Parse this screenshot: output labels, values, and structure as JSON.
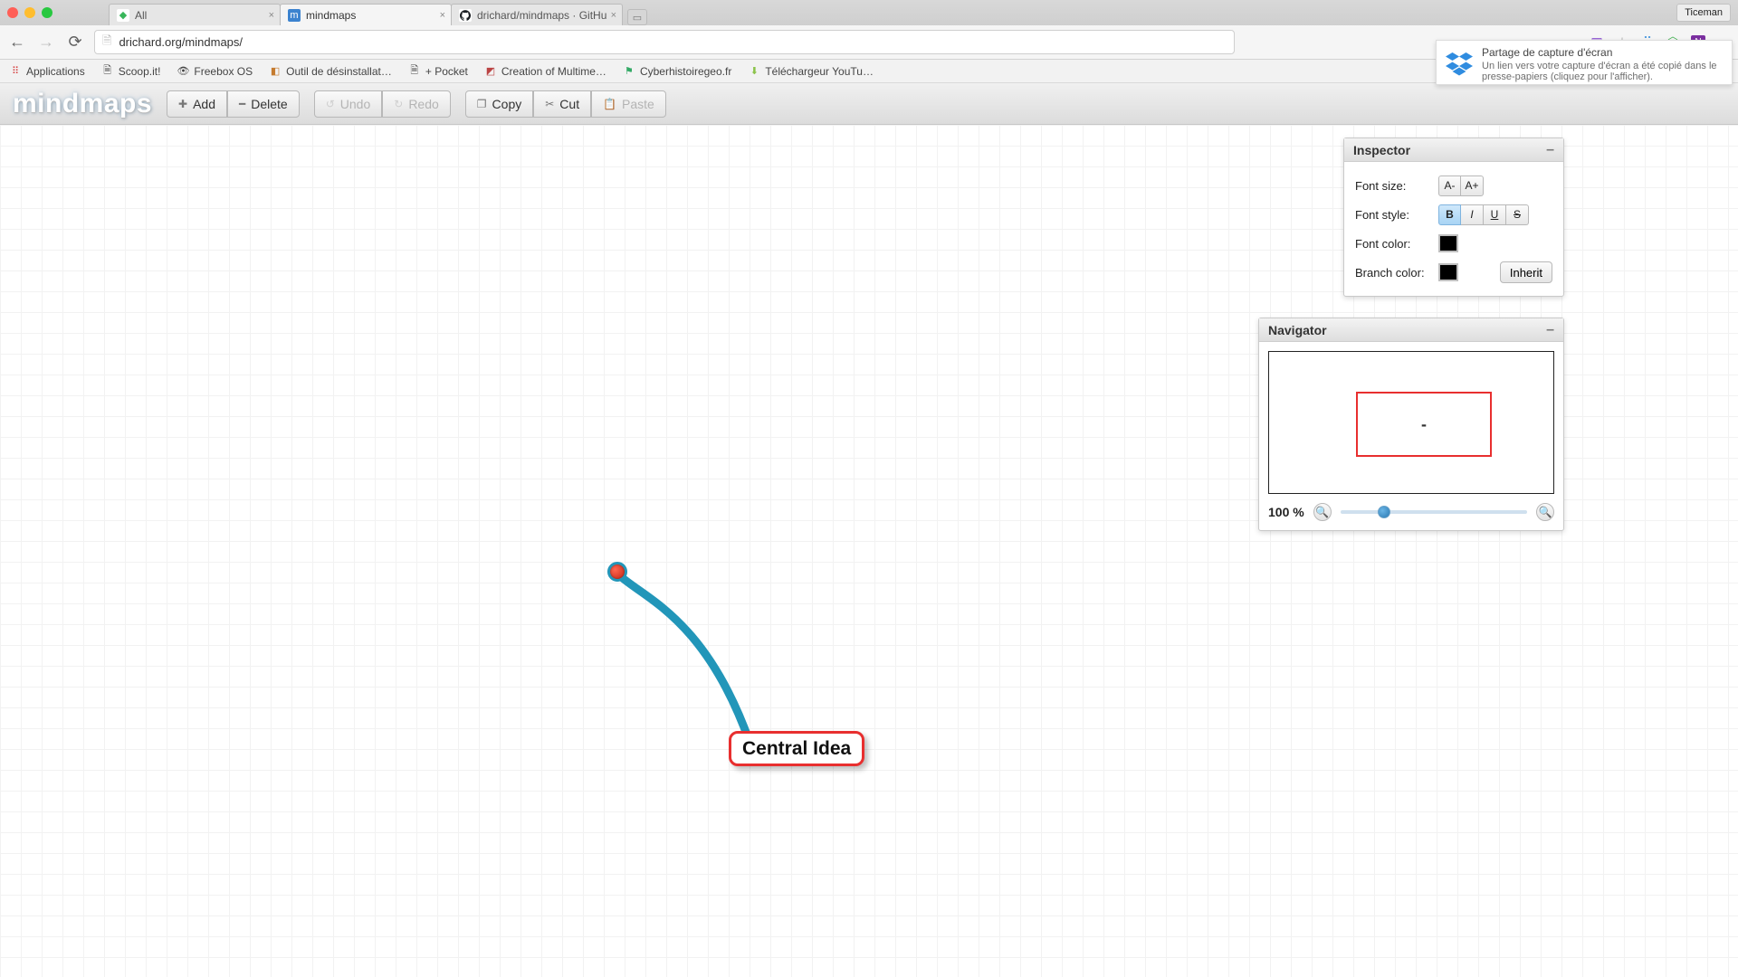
{
  "window": {
    "user_button": "Ticeman"
  },
  "browser_tabs": [
    {
      "title": "All",
      "favicon_bg": "#38b65a",
      "favicon_glyph": "◆",
      "active": false
    },
    {
      "title": "mindmaps",
      "favicon_bg": "#3c83cf",
      "favicon_glyph": "m",
      "active": true
    },
    {
      "title": "drichard/mindmaps · GitHu",
      "favicon_bg": "#1b1f23",
      "favicon_glyph": "",
      "active": false
    }
  ],
  "address_bar": {
    "url": "drichard.org/mindmaps/"
  },
  "bookmarks": [
    {
      "label": "Applications",
      "color": "#d64545"
    },
    {
      "label": "Scoop.it!",
      "color": "#6fb84b"
    },
    {
      "label": "Freebox OS",
      "color": "#888"
    },
    {
      "label": "Outil de désinstallat…",
      "color": "#c57b2e"
    },
    {
      "label": "+ Pocket",
      "color": "#888"
    },
    {
      "label": "Creation of Multime…",
      "color": "#b44"
    },
    {
      "label": "Cyberhistoiregeo.fr",
      "color": "#3a6"
    },
    {
      "label": "Téléchargeur YouTu…",
      "color": "#8bc34a"
    }
  ],
  "app": {
    "logo": "mindmaps"
  },
  "toolbar": {
    "add": "Add",
    "delete": "Delete",
    "undo": "Undo",
    "redo": "Redo",
    "copy": "Copy",
    "cut": "Cut",
    "paste": "Paste"
  },
  "mindmap": {
    "central_label": "Central Idea"
  },
  "inspector": {
    "title": "Inspector",
    "labels": {
      "font_size": "Font size:",
      "font_style": "Font style:",
      "font_color": "Font color:",
      "branch_color": "Branch color:"
    },
    "decrease": "A-",
    "increase": "A+",
    "bold": "B",
    "italic": "I",
    "underline": "U",
    "strike": "S",
    "inherit": "Inherit",
    "font_color": "#000000",
    "branch_color": "#000000"
  },
  "navigator": {
    "title": "Navigator",
    "zoom_label": "100 %",
    "viewport_glyph": "-"
  },
  "toast": {
    "title": "Partage de capture d'écran",
    "body": "Un lien vers votre capture d'écran a été copié dans le presse-papiers (cliquez pour l'afficher)."
  }
}
